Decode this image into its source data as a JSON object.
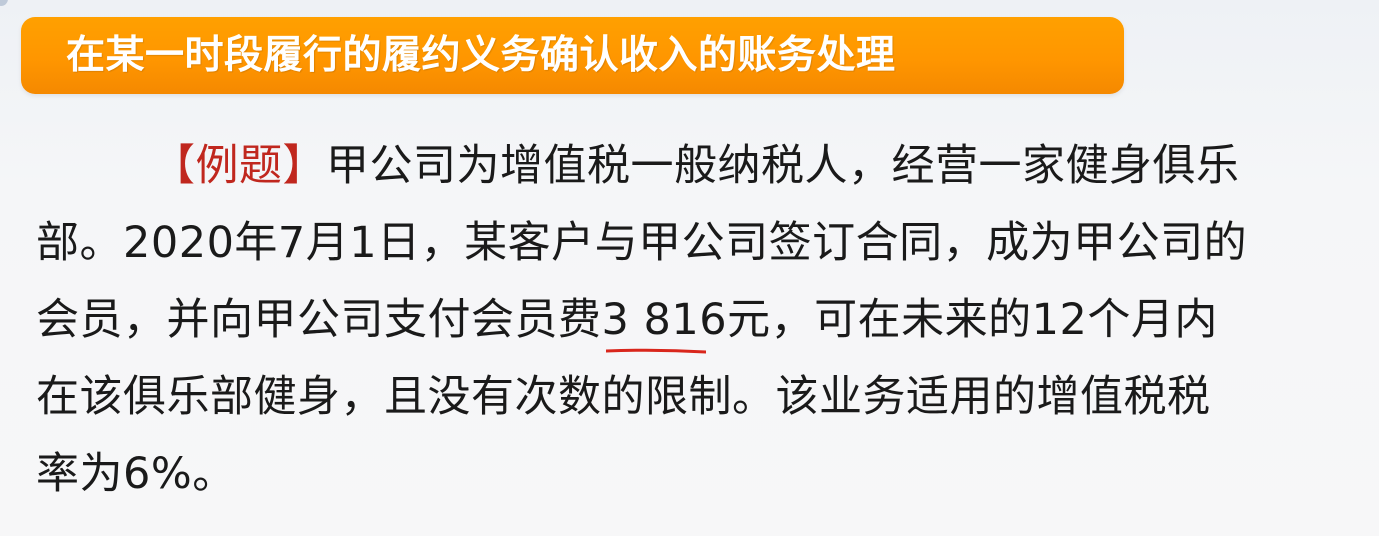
{
  "title": "在某一时段履行的履约义务确认收入的账务处理",
  "example": {
    "label": "【例题】",
    "line1": "甲公司为增值税一般纳税人，经营一家健身俱乐",
    "line2": "部。2020年7月1日，某客户与甲公司签订合同，成为甲公司的",
    "line3_before": "会员，并向甲公司支付会员费",
    "fee_amount": "3 816元",
    "line3_after": "，可在未来的12个月内",
    "line4": "在该俱乐部健身，且没有次数的限制。该业务适用的增值税税",
    "line5": "率为6%。"
  },
  "colors": {
    "title_bar": "#ff9a00",
    "title_text": "#ffffff",
    "example_label": "#c0271e",
    "body_text": "#1a1a1a",
    "underline": "#d9261c",
    "background": "#f3f4f6"
  }
}
